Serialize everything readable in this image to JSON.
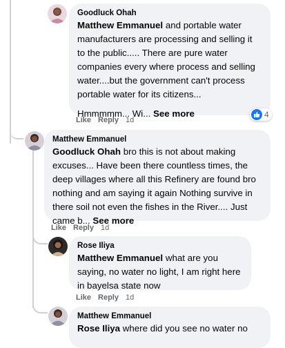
{
  "comments": [
    {
      "author": "Goodluck Ohah",
      "mention": "Matthew Emmanuel",
      "text": " and portable water manufacturers are processing and selling it to the public..... There are pure water companies every where process and selling water....but the government can't process portable water for its citizens...",
      "text2": "Hmmmmm... Wi... ",
      "see_more": "See more",
      "like": "Like",
      "reply": "Reply",
      "time": "1d",
      "reaction_count": "4",
      "reaction_icon": "like-icon",
      "accent": "#1877f2"
    },
    {
      "author": "Matthew Emmanuel",
      "mention": "Goodluck Ohah",
      "text": " bro this is not about making excuses... Have been there countless times, the deep villages where all this Refinery are found bro nothing and am saying it again Nothing survive in there soil not even the fishes in the River.... Just came b... ",
      "see_more": "See more",
      "like": "Like",
      "reply": "Reply",
      "time": "1d"
    },
    {
      "author": "Rose Iliya",
      "mention": "Matthew Emmanuel",
      "text": " what are you saying, no water no light, I am right here in bayelsa state now",
      "like": "Like",
      "reply": "Reply",
      "time": "1d"
    },
    {
      "author": "Matthew Emmanuel",
      "mention": "Rose Iliya",
      "text": " where did you see no water no"
    }
  ]
}
